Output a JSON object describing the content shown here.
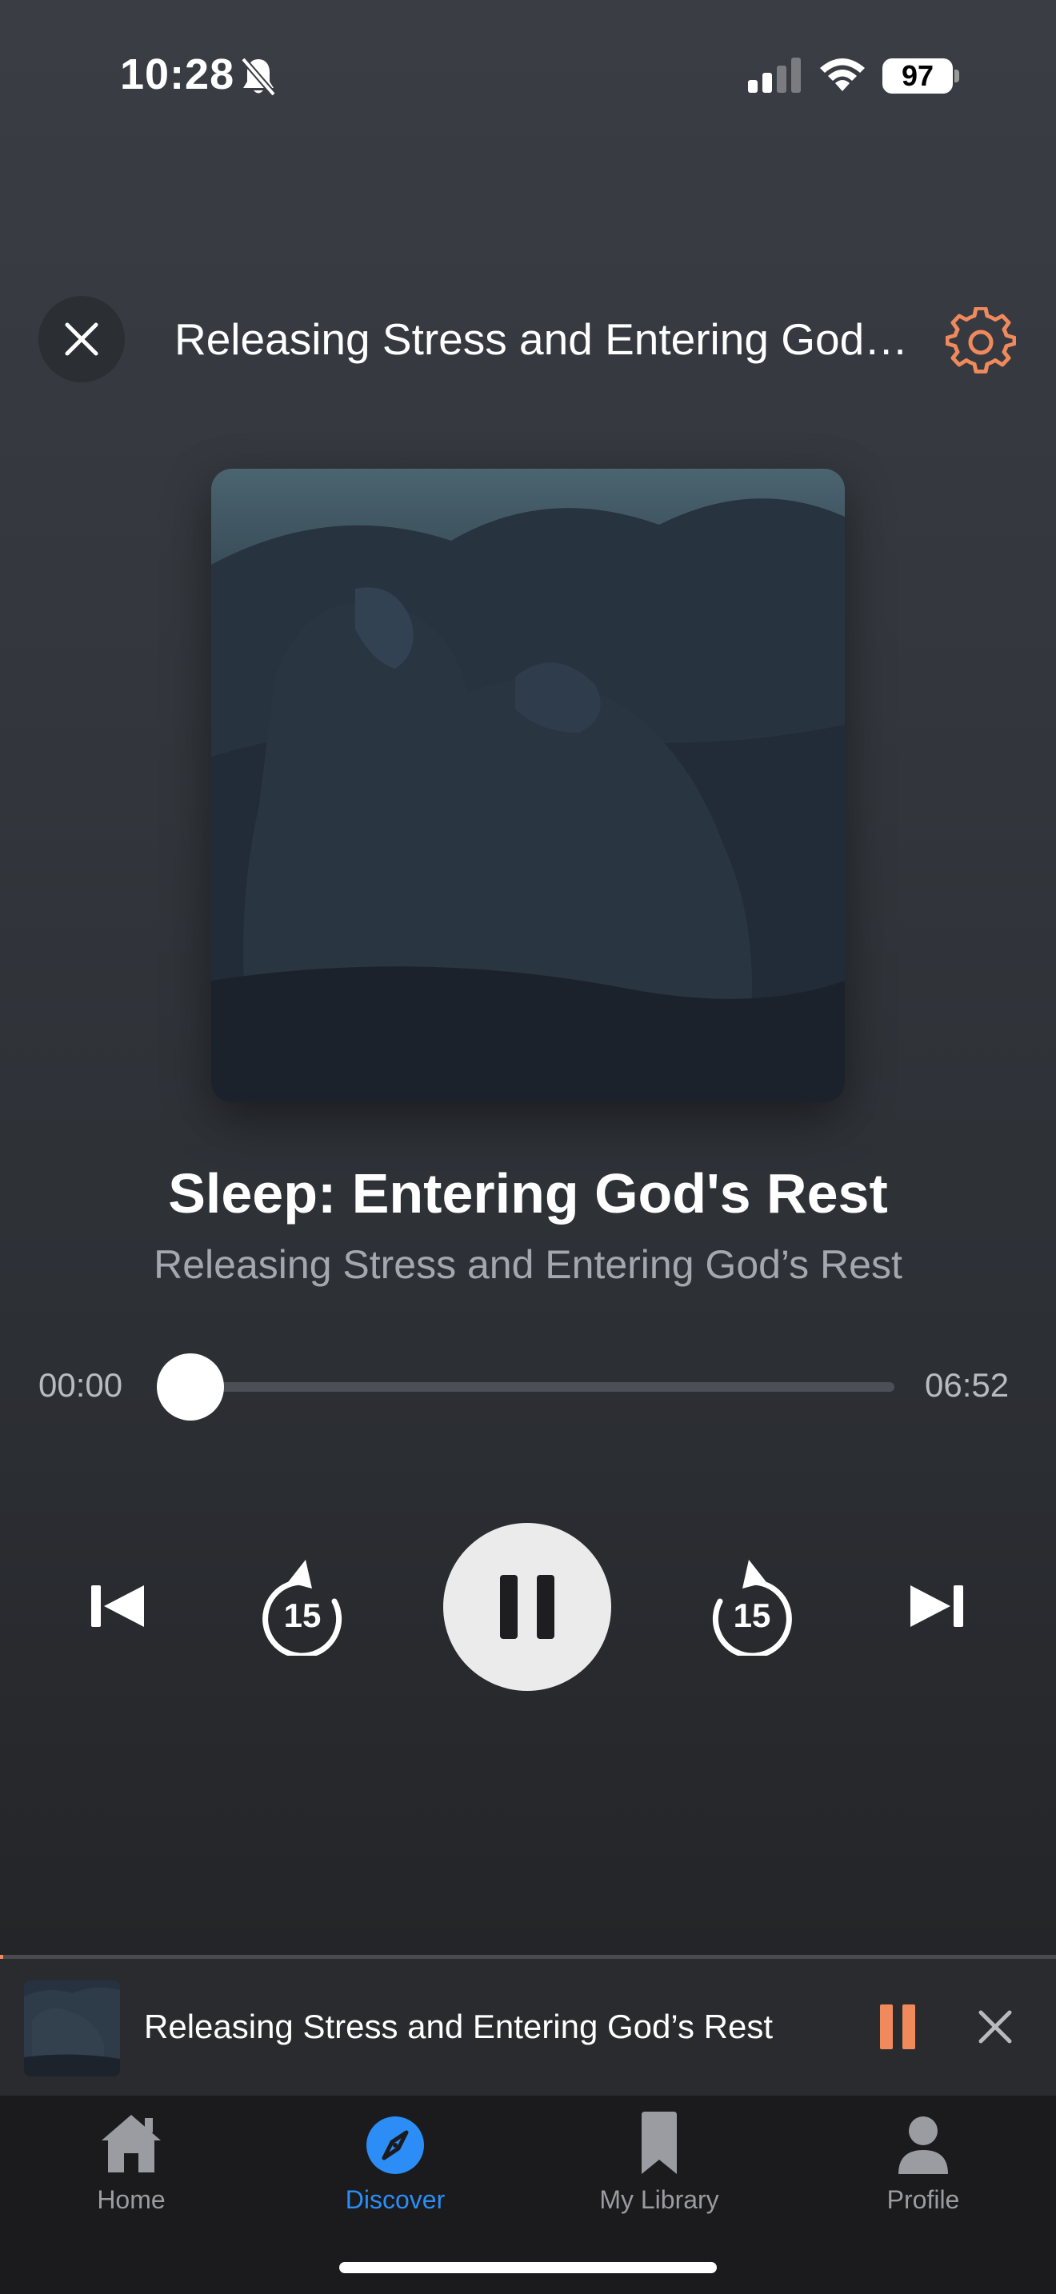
{
  "status_bar": {
    "time": "10:28",
    "battery": "97",
    "icons": [
      "bell-slash-icon",
      "cellular-signal-icon",
      "wifi-icon",
      "battery-icon"
    ]
  },
  "header": {
    "title": "Releasing Stress and Entering God's Rest",
    "close_icon": "close-icon",
    "settings_icon": "gear-icon",
    "accent_color": "#f08a5d"
  },
  "now_playing": {
    "title": "Sleep: Entering God's Rest",
    "subtitle": "Releasing Stress and Entering God’s Rest",
    "elapsed": "00:00",
    "duration": "06:52",
    "progress_fraction": 0.0
  },
  "controls": {
    "previous_icon": "skip-previous-icon",
    "rewind_icon": "rewind-15-icon",
    "rewind_label": "15",
    "pause_icon": "pause-icon",
    "forward_icon": "forward-15-icon",
    "forward_label": "15",
    "next_icon": "skip-next-icon"
  },
  "mini_player": {
    "title": "Releasing Stress and Entering God’s Rest",
    "pause_color": "#f08a5d",
    "close_icon": "close-icon"
  },
  "tabs": [
    {
      "label": "Home",
      "icon": "home-icon",
      "active": false
    },
    {
      "label": "Discover",
      "icon": "compass-icon",
      "active": true
    },
    {
      "label": "My Library",
      "icon": "bookmark-icon",
      "active": false
    },
    {
      "label": "Profile",
      "icon": "person-icon",
      "active": false
    }
  ],
  "colors": {
    "accent": "#f08a5d",
    "active_tab": "#2b8df5",
    "inactive_tab": "#9b9ca1"
  }
}
